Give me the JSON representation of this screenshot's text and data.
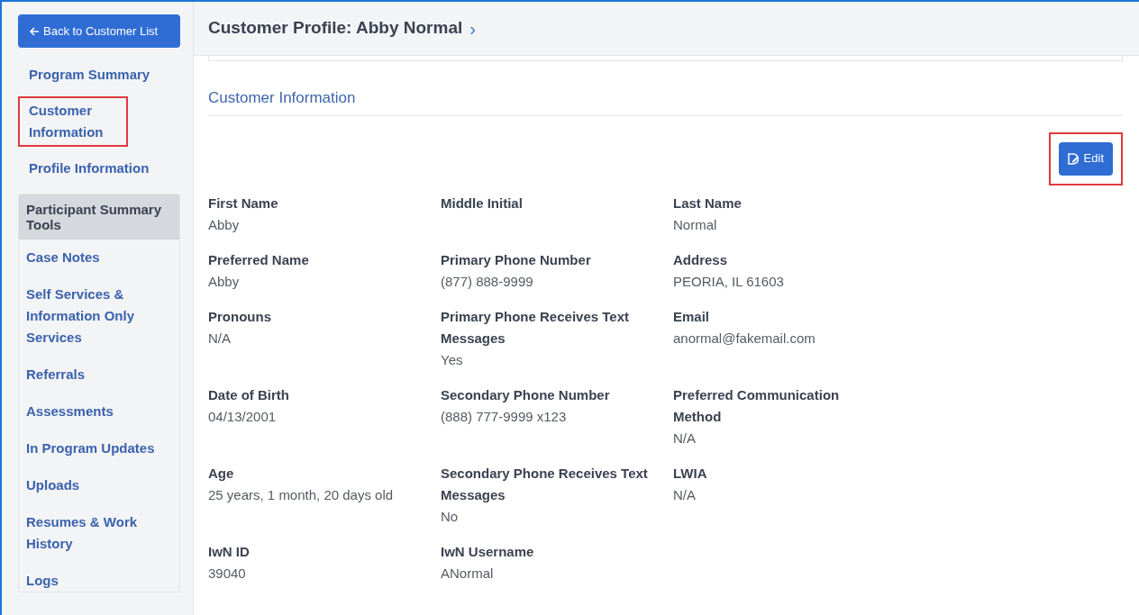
{
  "back_button": {
    "label": "Back to Customer List"
  },
  "nav": [
    {
      "label": "Program Summary",
      "highlighted": false
    },
    {
      "label": "Customer Information",
      "highlighted": true
    },
    {
      "label": "Profile Information",
      "highlighted": false
    }
  ],
  "tools_panel": {
    "title": "Participant Summary Tools",
    "items": [
      "Case Notes",
      "Self Services & Information Only Services",
      "Referrals",
      "Assessments",
      "In Program Updates",
      "Uploads",
      "Resumes & Work History",
      "Logs"
    ]
  },
  "header": {
    "title": "Customer Profile: Abby Normal",
    "chevron": "›"
  },
  "section": {
    "title": "Customer Information"
  },
  "edit_button": {
    "label": "Edit",
    "highlighted": true
  },
  "fields": [
    {
      "label": "First Name",
      "value": "Abby"
    },
    {
      "label": "Middle Initial"
    },
    {
      "label": "Last Name",
      "value": "Normal"
    },
    {
      "label": "Preferred Name",
      "value": "Abby"
    },
    {
      "label": "Primary Phone Number",
      "value": "(877) 888-9999"
    },
    {
      "label": "Address",
      "value": "PEORIA, IL 61603"
    },
    {
      "label": "Pronouns",
      "value": "N/A"
    },
    {
      "label": "Primary Phone Receives Text Messages",
      "value": "Yes"
    },
    {
      "label": "Email",
      "value": "anormal@fakemail.com"
    },
    {
      "label": "Date of Birth",
      "value": "04/13/2001"
    },
    {
      "label": "Secondary Phone Number",
      "value": "(888) 777-9999 x123"
    },
    {
      "label": "Preferred Communication Method",
      "value": "N/A"
    },
    {
      "label": "Age",
      "value": "25 years, 1 month, 20 days old"
    },
    {
      "label": "Secondary Phone Receives Text Messages",
      "value": "No"
    },
    {
      "label": "LWIA",
      "value": "N/A"
    },
    {
      "label": "IwN ID",
      "value": "39040"
    },
    {
      "label": "IwN Username",
      "value": "ANormal"
    }
  ]
}
